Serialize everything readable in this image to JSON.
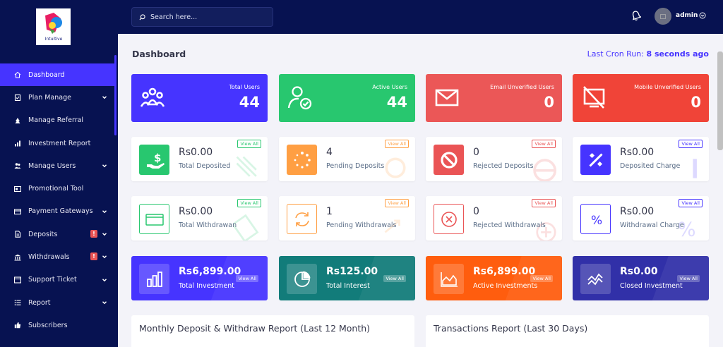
{
  "brand": {
    "logo_text": "Intuitive"
  },
  "sidebar": {
    "items": [
      {
        "label": "Dashboard",
        "icon": "home-icon",
        "active": true,
        "chevron": false,
        "alert": false
      },
      {
        "label": "Plan Manage",
        "icon": "clipboard-icon",
        "chevron": true,
        "alert": false
      },
      {
        "label": "Manage Referral",
        "icon": "tree-icon",
        "chevron": false,
        "alert": false
      },
      {
        "label": "Investment Report",
        "icon": "bar-chart-icon",
        "chevron": false,
        "alert": false
      },
      {
        "label": "Manage Users",
        "icon": "users-icon",
        "chevron": true,
        "alert": false
      },
      {
        "label": "Promotional Tool",
        "icon": "ad-icon",
        "chevron": false,
        "alert": false
      },
      {
        "label": "Payment Gateways",
        "icon": "credit-card-icon",
        "chevron": true,
        "alert": false
      },
      {
        "label": "Deposits",
        "icon": "file-invoice-icon",
        "chevron": true,
        "alert": true
      },
      {
        "label": "Withdrawals",
        "icon": "bank-icon",
        "chevron": true,
        "alert": true
      },
      {
        "label": "Support Ticket",
        "icon": "ticket-icon",
        "chevron": true,
        "alert": false
      },
      {
        "label": "Report",
        "icon": "list-icon",
        "chevron": true,
        "alert": false
      },
      {
        "label": "Subscribers",
        "icon": "thumbs-up-icon",
        "chevron": false,
        "alert": false
      }
    ],
    "alert_glyph": "!"
  },
  "header": {
    "search_placeholder": "Search here...",
    "username": "admin"
  },
  "page": {
    "title": "Dashboard",
    "cron_label": "Last Cron Run:",
    "cron_value": "8 seconds ago"
  },
  "stat_cards": [
    {
      "title": "Total Users",
      "value": "44",
      "color": "#4634ff",
      "icon": "users-group-icon"
    },
    {
      "title": "Active Users",
      "value": "44",
      "color": "#28c76f",
      "icon": "user-check-icon"
    },
    {
      "title": "Email Unverified Users",
      "value": "0",
      "color": "#eb5757",
      "icon": "envelope-icon"
    },
    {
      "title": "Mobile Unverified Users",
      "value": "0",
      "color": "#f04438",
      "icon": "mobile-slash-icon"
    }
  ],
  "deposit_cards": [
    {
      "value": "Rs0.00",
      "label": "Total Deposited",
      "view": "View All",
      "color": "#28c76f",
      "icon": "hand-dollar-icon"
    },
    {
      "value": "4",
      "label": "Pending Deposits",
      "view": "View All",
      "color": "#ff9f43",
      "icon": "spinner-icon"
    },
    {
      "value": "0",
      "label": "Rejected Deposits",
      "view": "View All",
      "color": "#ea5455",
      "icon": "ban-icon"
    },
    {
      "value": "Rs0.00",
      "label": "Deposited Charge",
      "view": "View All",
      "color": "#4634ff",
      "icon": "percent-icon"
    }
  ],
  "withdraw_cards": [
    {
      "value": "Rs0.00",
      "label": "Total Withdrawan",
      "view": "View All",
      "color": "#28c76f",
      "icon": "card-icon"
    },
    {
      "value": "1",
      "label": "Pending Withdrawals",
      "view": "View All",
      "color": "#ff9f43",
      "icon": "sync-icon"
    },
    {
      "value": "0",
      "label": "Rejected Withdrawals",
      "view": "View All",
      "color": "#ea5455",
      "icon": "times-circle-icon"
    },
    {
      "value": "Rs0.00",
      "label": "Withdrawal Charge",
      "view": "View All",
      "color": "#4634ff",
      "icon": "percent-icon"
    }
  ],
  "invest_cards": [
    {
      "value": "Rs6,899.00",
      "label": "Total Investment",
      "view": "View All",
      "color": "#4634ff",
      "icon": "chart-bar-icon"
    },
    {
      "value": "Rs125.00",
      "label": "Total Interest",
      "view": "View All",
      "color": "#127c7a",
      "icon": "chart-pie-icon"
    },
    {
      "value": "Rs6,899.00",
      "label": "Active Investments",
      "view": "View All",
      "color": "#ff5d0e",
      "icon": "chart-area-icon"
    },
    {
      "value": "Rs0.00",
      "label": "Closed Investment",
      "view": "View All",
      "color": "#3130a8",
      "icon": "chart-line-icon"
    }
  ],
  "panels": [
    {
      "title": "Monthly Deposit & Withdraw Report (Last 12 Month)"
    },
    {
      "title": "Transactions Report (Last 30 Days)"
    }
  ]
}
